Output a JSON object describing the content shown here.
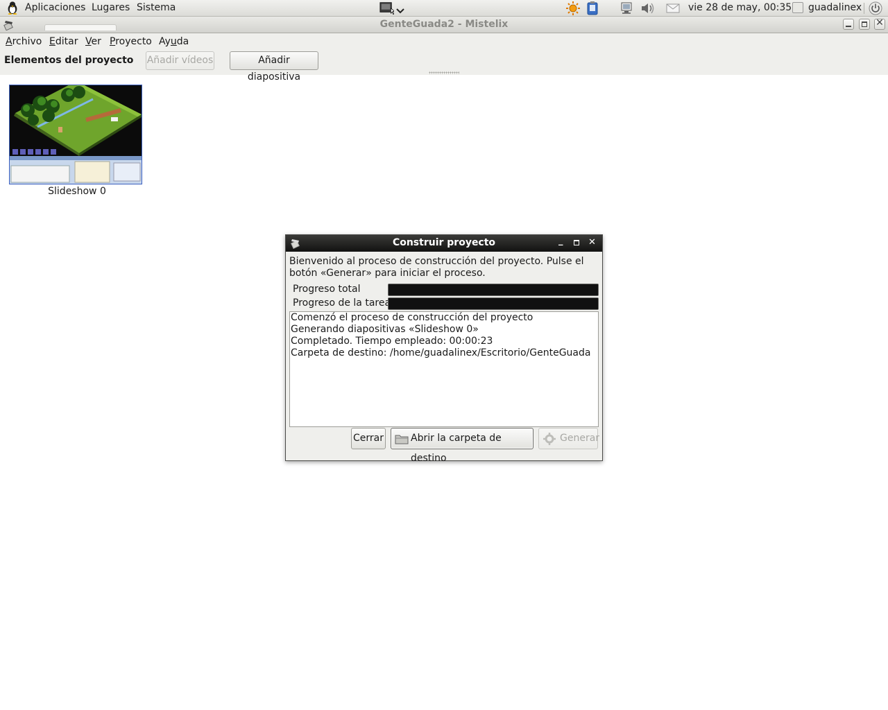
{
  "panel": {
    "menus": [
      "Aplicaciones",
      "Lugares",
      "Sistema"
    ],
    "clock": "vie 28 de may, 00:35",
    "user": "guadalinex"
  },
  "window": {
    "title": "GenteGuada2 - Mistelix"
  },
  "menubar": {
    "items": [
      {
        "mnemonic": "A",
        "rest": "rchivo"
      },
      {
        "mnemonic": "E",
        "rest": "ditar"
      },
      {
        "mnemonic": "V",
        "rest": "er"
      },
      {
        "mnemonic": "P",
        "rest": "royecto"
      },
      {
        "pre": "Ay",
        "mnemonic": "u",
        "rest": "da"
      }
    ]
  },
  "toolbar": {
    "heading": "Elementos del proyecto",
    "add_videos": "Añadir vídeos",
    "add_slide": "Añadir diapositiva"
  },
  "project": {
    "items": [
      {
        "label": "Slideshow 0"
      }
    ]
  },
  "dialog": {
    "title": "Construir proyecto",
    "intro": "Bienvenido al proceso de construcción del proyecto. Pulse el botón «Generar» para iniciar el proceso.",
    "total_label": "Progreso total",
    "task_label": "Progreso de la tarea",
    "total_progress": 1.0,
    "task_progress": 1.0,
    "log": [
      "Comenzó el proceso de construcción del proyecto",
      "Generando diapositivas «Slideshow 0»",
      "Completado. Tiempo empleado: 00:00:23",
      "Carpeta de destino: /home/guadalinex/Escritorio/GenteGuada"
    ],
    "close_label": "Cerrar",
    "open_folder_label": "Abrir la carpeta de destino",
    "generate_label": "Generar"
  },
  "colors": {
    "dialog_titlebar": "#121211",
    "selection_border": "#3a5fbf",
    "progress_fill": "#111111"
  }
}
